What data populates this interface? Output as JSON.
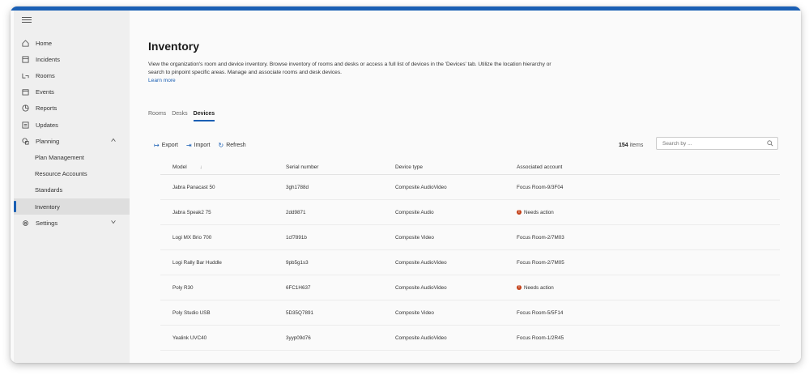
{
  "sidebar": {
    "items": [
      {
        "label": "Home",
        "icon": "home-icon"
      },
      {
        "label": "Incidents",
        "icon": "incidents-icon"
      },
      {
        "label": "Rooms",
        "icon": "rooms-icon"
      },
      {
        "label": "Events",
        "icon": "events-icon"
      },
      {
        "label": "Reports",
        "icon": "reports-icon"
      },
      {
        "label": "Updates",
        "icon": "updates-icon"
      },
      {
        "label": "Planning",
        "icon": "planning-icon"
      }
    ],
    "planning_sub": [
      "Plan Management",
      "Resource Accounts",
      "Standards",
      "Inventory"
    ],
    "settings": {
      "label": "Settings",
      "icon": "gear-icon"
    }
  },
  "main": {
    "title": "Inventory",
    "description": "View the organization's room and device inventory. Browse inventory of rooms and desks or access a full list of devices in the 'Devices' tab. Utilize the location hierarchy or search to pinpoint specific areas. Manage and associate rooms and desk devices.",
    "learn_more": "Learn more",
    "tabs": [
      "Rooms",
      "Desks",
      "Devices"
    ],
    "active_tab": "Devices",
    "toolbar": {
      "export": "Export",
      "import": "Import",
      "refresh": "Refresh"
    },
    "count_num": "154",
    "count_label": "items",
    "search_placeholder": "Search by ...",
    "columns": [
      "Model",
      "Serial number",
      "Device type",
      "Associated account"
    ],
    "rows": [
      {
        "model": "Jabra Panacast 50",
        "serial": "3gh1788d",
        "type": "Composite AudioVideo",
        "account": "Focus Room-9/3F04",
        "warn": false
      },
      {
        "model": "Jabra Speak2 75",
        "serial": "2dd9871",
        "type": "Composite Audio",
        "account": "Needs action",
        "warn": true
      },
      {
        "model": "Logi MX Brio 700",
        "serial": "1cf7891b",
        "type": "Composite Video",
        "account": "Focus Room-2/7M03",
        "warn": false
      },
      {
        "model": "Logi Rally Bar Huddle",
        "serial": "9pb5g1s3",
        "type": "Composite AudioVideo",
        "account": "Focus Room-2/7M05",
        "warn": false
      },
      {
        "model": "Poly R30",
        "serial": "6FC1H637",
        "type": "Composite AudioVideo",
        "account": "Needs action",
        "warn": true
      },
      {
        "model": "Poly Studio USB",
        "serial": "5D35Q7891",
        "type": "Composite Video",
        "account": "Focus Room-5/5F14",
        "warn": false
      },
      {
        "model": "Yealink UVC40",
        "serial": "3yyp09d76",
        "type": "Composite AudioVideo",
        "account": "Focus Room-1/2R45",
        "warn": false
      }
    ]
  }
}
